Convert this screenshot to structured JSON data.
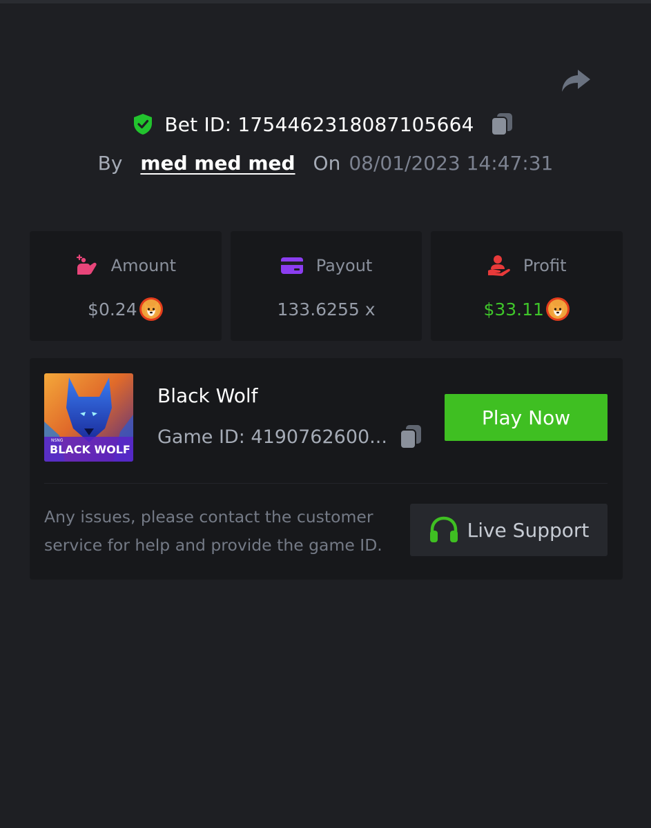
{
  "header": {
    "bet_id_label": "Bet ID: 1754462318087105664",
    "by_word": "By",
    "username": "med med med",
    "on_word": "On",
    "datetime": "08/01/2023 14:47:31"
  },
  "stats": [
    {
      "title": "Amount",
      "value": "$0.24",
      "icon": "amount-icon",
      "coin": "shib-coin-icon"
    },
    {
      "title": "Payout",
      "value": "133.6255 x",
      "icon": "card-icon"
    },
    {
      "title": "Profit",
      "value": "$33.11",
      "icon": "profit-icon",
      "coin": "shib-coin-icon"
    }
  ],
  "game": {
    "name": "Black Wolf",
    "game_id_label": "Game ID: 4190762600...",
    "play_button": "Play Now",
    "thumbnail_text": "BLACK WOLF",
    "thumbnail_brand": "NSNG"
  },
  "support": {
    "help_text": "Any issues, please contact the customer service for help and provide the game ID.",
    "button_label": "Live Support"
  },
  "colors": {
    "background": "#1e1f23",
    "card": "#17181b",
    "accent_green": "#3fbf22",
    "profit_green": "#3fc52a",
    "amount_pink": "#e8457a",
    "payout_purple": "#8b3df0",
    "profit_red": "#e83a3a"
  }
}
